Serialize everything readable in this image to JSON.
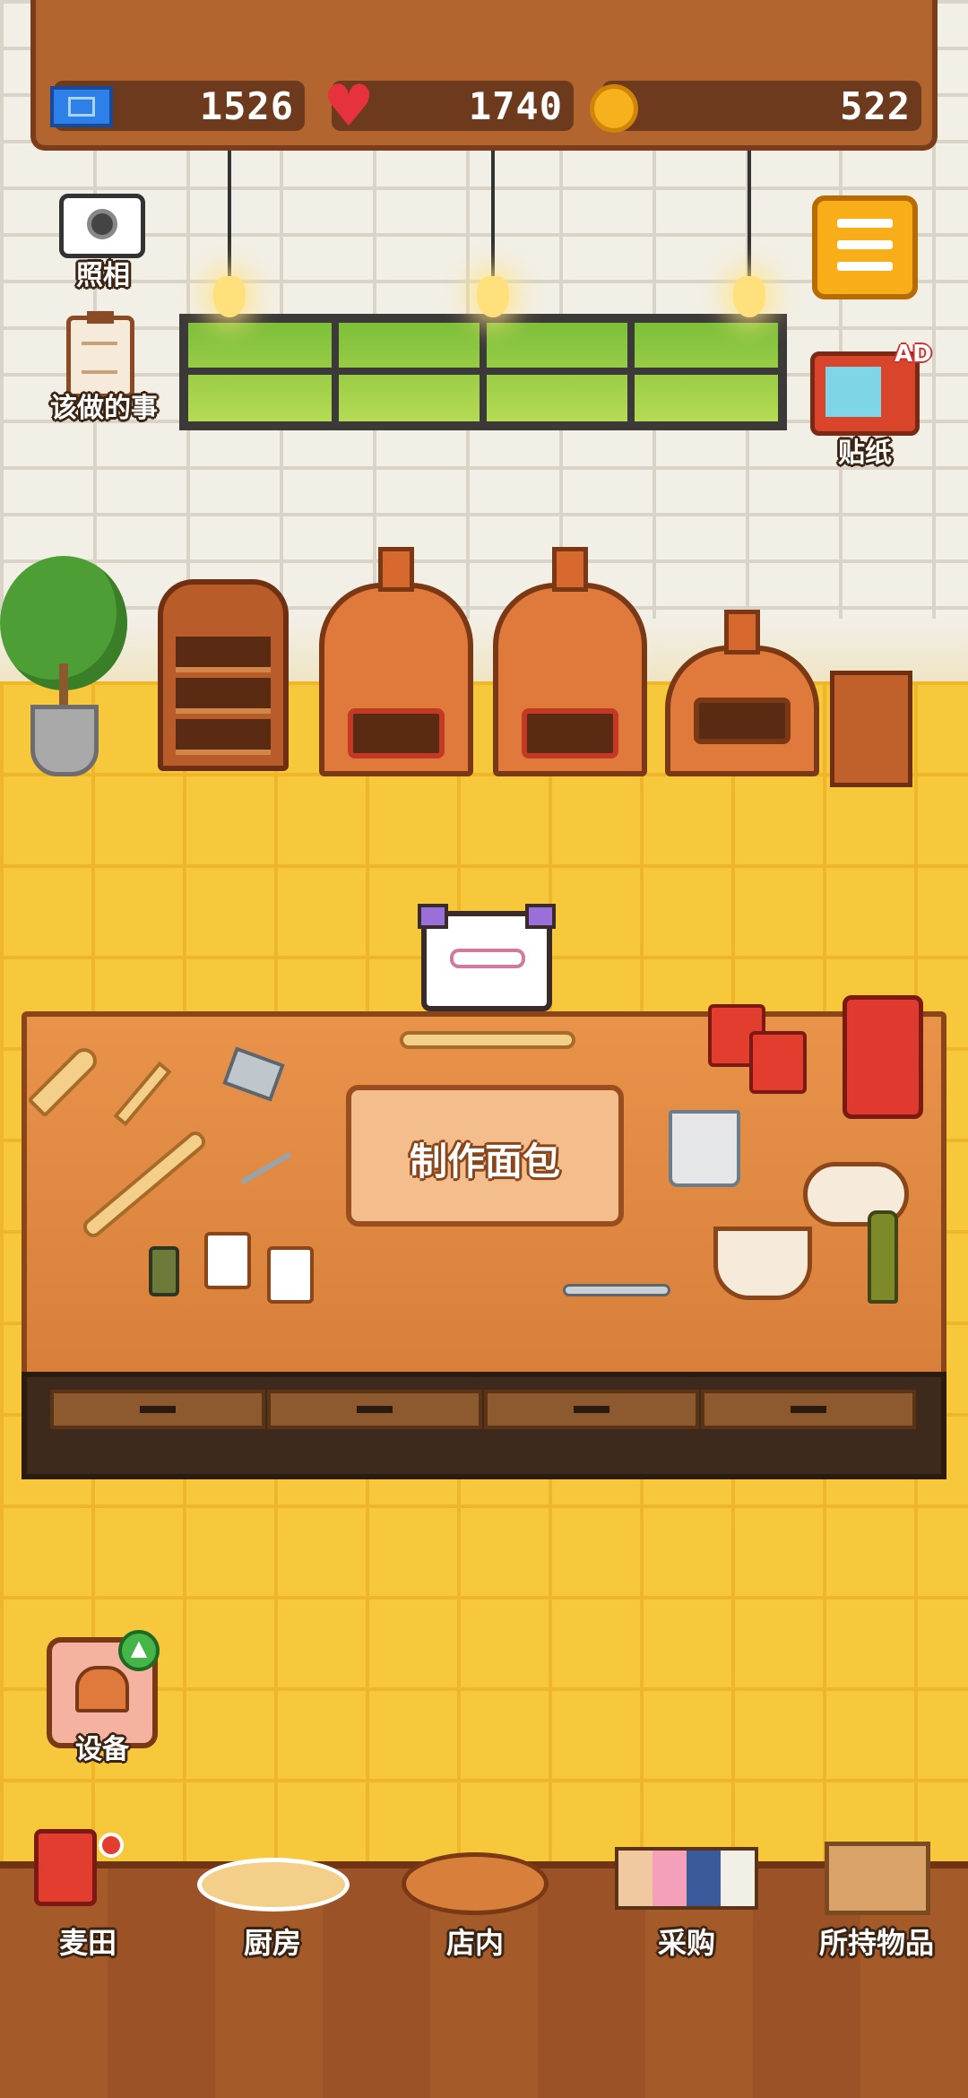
{
  "resources": {
    "tickets": "1526",
    "hearts": "1740",
    "coins": "522"
  },
  "left_buttons": {
    "camera_label": "照相",
    "todo_label": "该做的事"
  },
  "right_buttons": {
    "sticker_label": "贴纸",
    "ad_badge": "AD"
  },
  "counter": {
    "make_bread_label": "制作面包"
  },
  "equipment": {
    "label": "设备"
  },
  "bottom_nav": {
    "items": [
      {
        "label": "麦田",
        "icon": "wheat-field-icon"
      },
      {
        "label": "厨房",
        "icon": "kitchen-icon"
      },
      {
        "label": "店内",
        "icon": "store-icon"
      },
      {
        "label": "采购",
        "icon": "purchase-icon"
      },
      {
        "label": "所持物品",
        "icon": "inventory-icon"
      }
    ]
  },
  "colors": {
    "floor": "#F7C83C",
    "wood": "#B2652E",
    "accent_orange": "#F7AE18",
    "text_outline": "#3B2412"
  }
}
